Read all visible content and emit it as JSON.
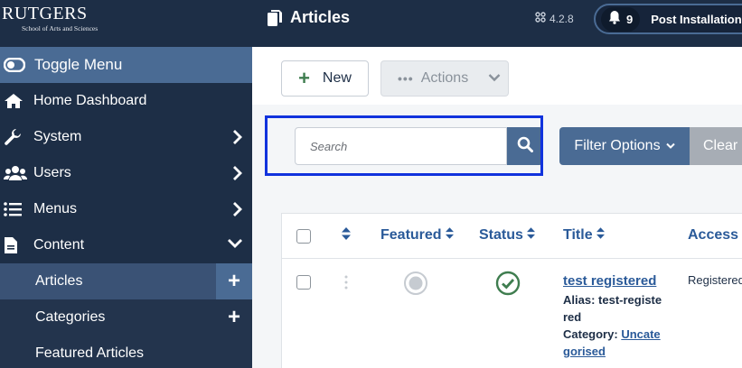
{
  "brand": {
    "name": "RUTGERS",
    "subtitle": "School of Arts and Sciences"
  },
  "sidebar": {
    "toggle_label": "Toggle Menu",
    "items": [
      {
        "label": "Home Dashboard",
        "icon": "home-icon"
      },
      {
        "label": "System",
        "icon": "wrench-icon"
      },
      {
        "label": "Users",
        "icon": "users-icon"
      },
      {
        "label": "Menus",
        "icon": "list-icon"
      },
      {
        "label": "Content",
        "icon": "file-icon"
      }
    ],
    "content_submenu": [
      {
        "label": "Articles",
        "active": true
      },
      {
        "label": "Categories",
        "active": false
      },
      {
        "label": "Featured Articles",
        "active": false
      }
    ]
  },
  "header": {
    "title": "Articles",
    "version": "4.2.8",
    "notification_count": "9",
    "notification_text": "Post Installation Mes"
  },
  "toolbar": {
    "new_label": "New",
    "actions_label": "Actions"
  },
  "search": {
    "placeholder": "Search",
    "filter_label": "Filter Options",
    "clear_label": "Clear"
  },
  "table": {
    "headers": {
      "featured": "Featured",
      "status": "Status",
      "title": "Title",
      "access": "Access"
    },
    "rows": [
      {
        "title": "test registered",
        "alias_label": "Alias:",
        "alias": "test-registe red",
        "category_label": "Category:",
        "category": "Uncate gorised",
        "access": "Registered",
        "status": "published",
        "featured": false
      }
    ]
  },
  "colors": {
    "sidebar_bg": "#1d2e46",
    "accent": "#4a6b94",
    "link": "#2a5a99",
    "success": "#3f7d4f",
    "highlight": "#1133dd"
  }
}
